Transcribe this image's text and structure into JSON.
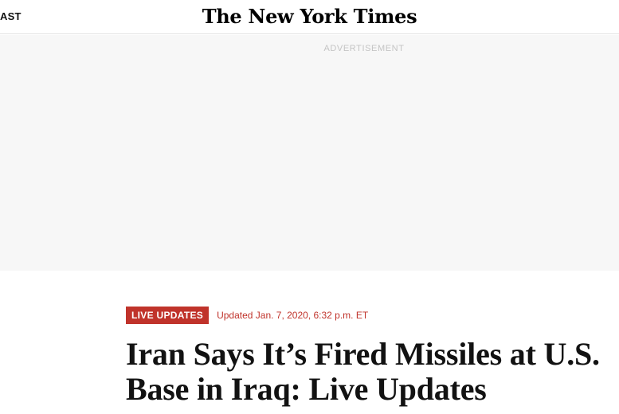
{
  "masthead": {
    "section_label": "AST",
    "logo_text": "The New York Times"
  },
  "ad": {
    "label": "ADVERTISEMENT"
  },
  "article": {
    "badge": "LIVE UPDATES",
    "timestamp": "Updated Jan. 7, 2020, 6:32 p.m. ET",
    "headline": "Iran Says It’s Fired Missiles at U.S. Base in Iraq: Live Updates"
  },
  "colors": {
    "accent": "#c0332b",
    "ad_background": "#f7f7f7",
    "text": "#121212"
  }
}
